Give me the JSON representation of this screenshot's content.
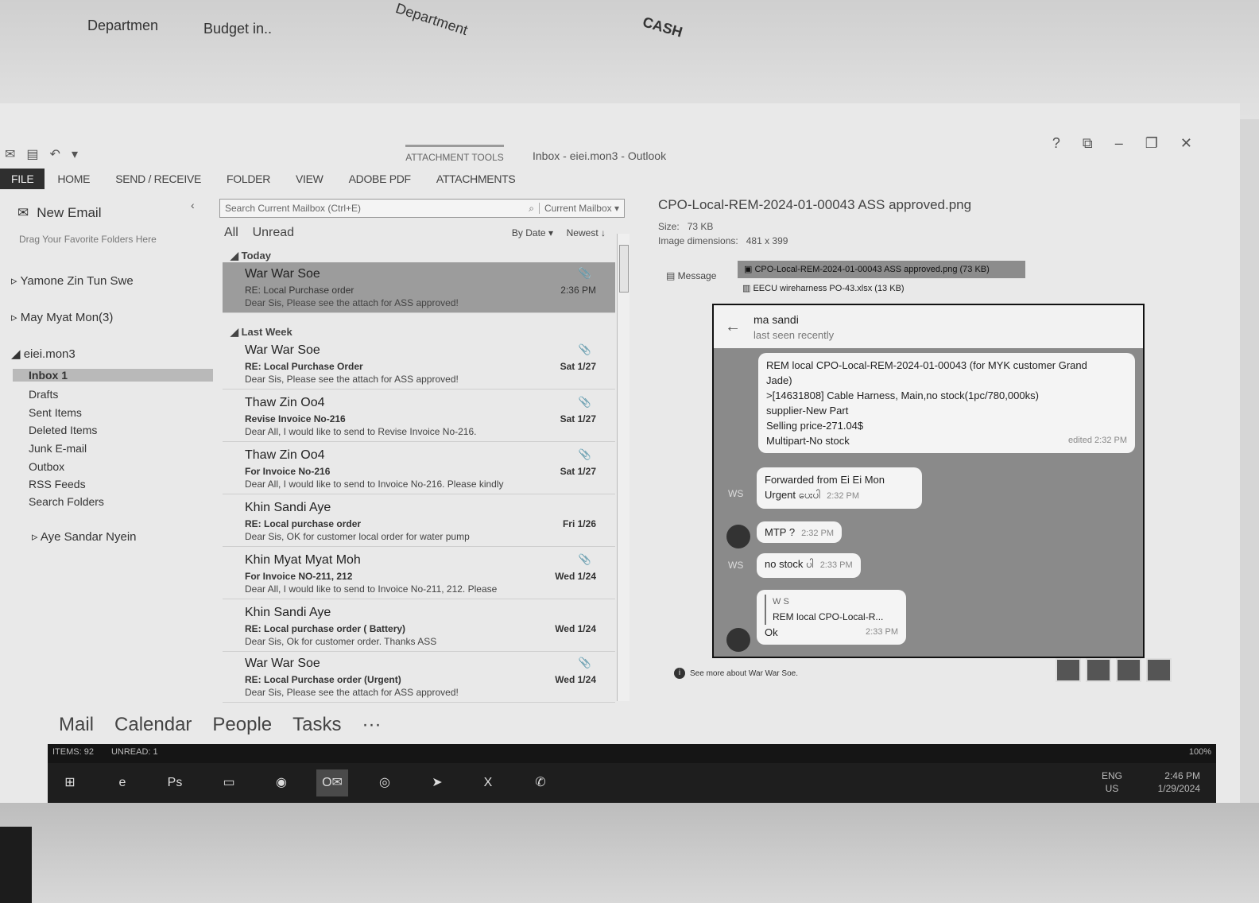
{
  "background": {
    "paper_words": [
      "Departmen",
      "Budget in..",
      "Department",
      "CASH"
    ]
  },
  "window": {
    "title": "Inbox - eiei.mon3 - Outlook",
    "context_tools": "ATTACHMENT TOOLS",
    "controls": [
      "?",
      "⧉",
      "–",
      "❐",
      "✕"
    ]
  },
  "ribbon": {
    "tabs": [
      "FILE",
      "HOME",
      "SEND / RECEIVE",
      "FOLDER",
      "VIEW",
      "ADOBE PDF",
      "ATTACHMENTS"
    ]
  },
  "folder_pane": {
    "new_email": "New Email",
    "drag_hint": "Drag Your Favorite Folders Here",
    "accounts": [
      {
        "name": "Yamone Zin Tun Swe",
        "expanded": false
      },
      {
        "name": "May Myat Mon(3)",
        "expanded": false
      },
      {
        "name": "eiei.mon3",
        "expanded": true
      },
      {
        "name": "Aye Sandar Nyein",
        "expanded": false
      }
    ],
    "folders": [
      {
        "label": "Inbox 1",
        "selected": true
      },
      {
        "label": "Drafts"
      },
      {
        "label": "Sent Items"
      },
      {
        "label": "Deleted Items"
      },
      {
        "label": "Junk E-mail"
      },
      {
        "label": "Outbox"
      },
      {
        "label": "RSS Feeds"
      },
      {
        "label": "Search Folders"
      }
    ]
  },
  "message_list": {
    "search_placeholder": "Search Current Mailbox (Ctrl+E)",
    "search_scope": "Current Mailbox",
    "filters": {
      "all": "All",
      "unread": "Unread",
      "sort_by": "By Date",
      "order": "Newest ↓"
    },
    "groups": {
      "today": "Today",
      "last_week": "Last Week"
    },
    "items": [
      {
        "from": "War War Soe",
        "subject": "RE: Local Purchase order",
        "preview": "Dear Sis, Please see the attach for ASS approved!",
        "date": "2:36 PM",
        "attachment": true,
        "selected": true
      },
      {
        "from": "War War Soe",
        "subject": "RE: Local Purchase Order",
        "preview": "Dear Sis, Please see the attach for ASS approved!",
        "date": "Sat 1/27",
        "attachment": true
      },
      {
        "from": "Thaw Zin Oo4",
        "subject": "Revise Invoice No-216",
        "preview": "Dear All, I would like to send to Revise Invoice No-216.",
        "date": "Sat 1/27",
        "attachment": true
      },
      {
        "from": "Thaw Zin Oo4",
        "subject": "For Invoice No-216",
        "preview": "Dear All, I would like to send to Invoice No-216. Please kindly",
        "date": "Sat 1/27",
        "attachment": true
      },
      {
        "from": "Khin Sandi Aye",
        "subject": "RE: Local purchase order",
        "preview": "Dear Sis, OK for customer local order for water pump",
        "date": "Fri 1/26",
        "attachment": false
      },
      {
        "from": "Khin Myat Myat Moh",
        "subject": "For Invoice NO-211, 212",
        "preview": "Dear All, I would like to send to Invoice No-211, 212. Please",
        "date": "Wed 1/24",
        "attachment": true
      },
      {
        "from": "Khin Sandi Aye",
        "subject": "RE: Local purchase order ( Battery)",
        "preview": "Dear Sis, Ok for customer order. Thanks ASS",
        "date": "Wed 1/24",
        "attachment": false
      },
      {
        "from": "War War Soe",
        "subject": "RE: Local Purchase order (Urgent)",
        "preview": "Dear Sis, Please see the attach for ASS approved!",
        "date": "Wed 1/24",
        "attachment": true
      }
    ]
  },
  "reading_pane": {
    "attachment_title": "CPO-Local-REM-2024-01-00043 ASS approved.png",
    "size_label": "Size:",
    "size_value": "73 KB",
    "dims_label": "Image dimensions:",
    "dims_value": "481 x 399",
    "message_label": "Message",
    "attachment_1": "CPO-Local-REM-2024-01-00043 ASS approved.png (73 KB)",
    "attachment_2": "EECU wireharness PO-43.xlsx (13 KB)",
    "see_more": "See more about War War Soe.",
    "chat": {
      "contact": "ma sandi",
      "status": "last seen recently",
      "messages": [
        {
          "lines": [
            "REM local CPO-Local-REM-2024-01-00043 (for MYK customer Grand",
            "Jade)",
            ">[14631808] Cable Harness, Main,no stock(1pc/780,000ks)",
            "supplier-New Part",
            "Selling price-271.04$",
            "Multipart-No stock"
          ],
          "time": "edited 2:32 PM"
        },
        {
          "header": "Forwarded from Ei Ei Mon",
          "text": "Urgent ပေးပါ",
          "time": "2:32 PM",
          "avatar": "WS"
        },
        {
          "text": "MTP ?",
          "time": "2:32 PM"
        },
        {
          "text": "no stock ပါ",
          "time": "2:33 PM",
          "avatar": "WS"
        },
        {
          "quote_name": "W S",
          "quote_text": "REM local CPO-Local-R...",
          "text": "Ok",
          "time": "2:33 PM"
        }
      ]
    }
  },
  "nav": {
    "items": [
      "Mail",
      "Calendar",
      "People",
      "Tasks",
      "···"
    ]
  },
  "status": {
    "items": "ITEMS: 92",
    "unread": "UNREAD: 1",
    "zoom": "100%"
  },
  "taskbar": {
    "apps": [
      "start-icon",
      "ie-icon",
      "photoshop-icon",
      "file-explorer-icon",
      "edge-icon",
      "outlook-icon",
      "chrome-icon",
      "telegram-icon",
      "excel-icon",
      "viber-icon"
    ],
    "ps_label": "Ps",
    "excel_label": "X",
    "lang": "ENG",
    "region": "US",
    "time": "2:46 PM",
    "date": "1/29/2024"
  }
}
